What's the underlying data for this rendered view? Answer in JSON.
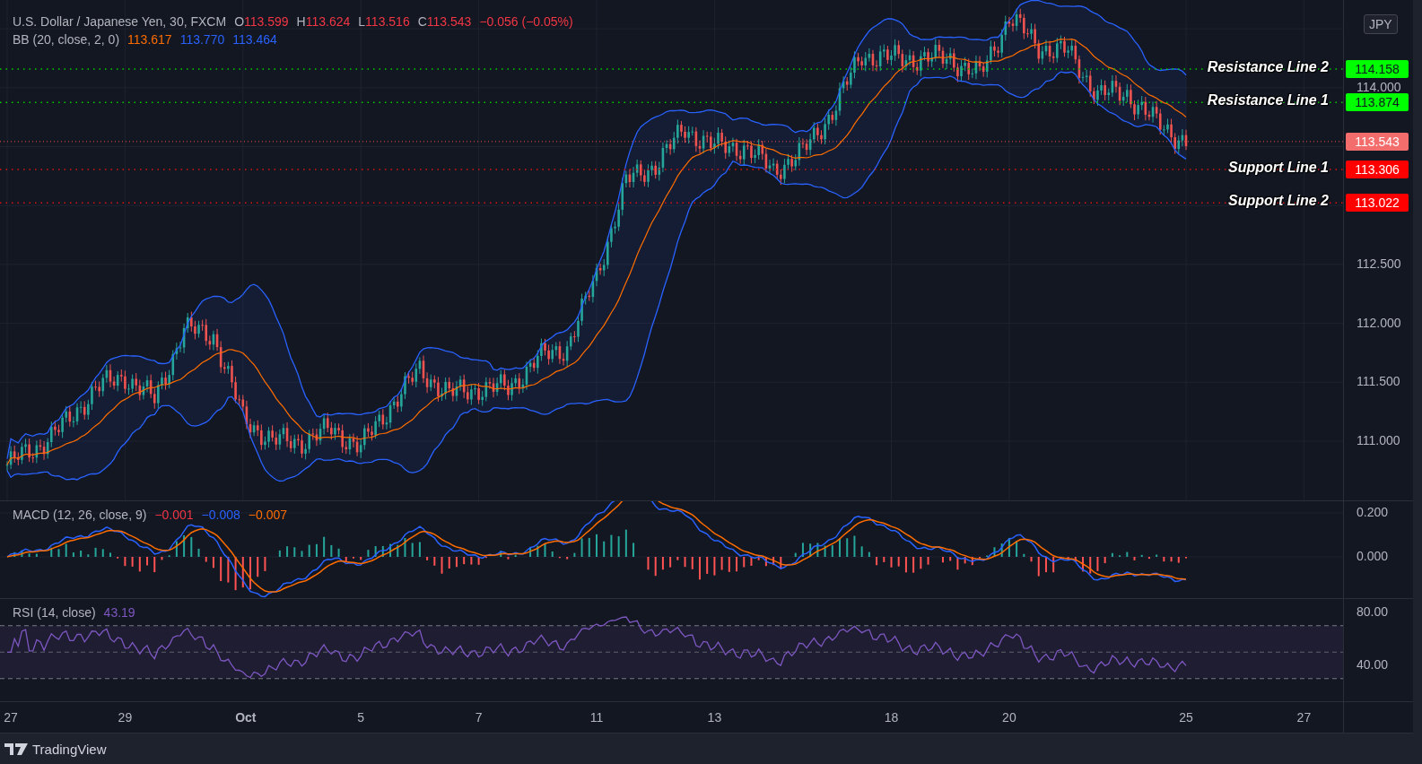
{
  "legend": {
    "symbol": "U.S. Dollar / Japanese Yen, 30, FXCM",
    "ohlc": [
      {
        "label": "O",
        "value": "113.599"
      },
      {
        "label": "H",
        "value": "113.624"
      },
      {
        "label": "L",
        "value": "113.516"
      },
      {
        "label": "C",
        "value": "113.543"
      }
    ],
    "change": "−0.056 (−0.05%)"
  },
  "bb_legend": {
    "label": "BB (20, close, 2, 0)",
    "values": [
      {
        "value": "113.617",
        "color": "#ff6d00"
      },
      {
        "value": "113.770",
        "color": "#2962ff"
      },
      {
        "value": "113.464",
        "color": "#2962ff"
      }
    ]
  },
  "currency_badge": "JPY",
  "levels": [
    {
      "label": "Resistance Line 2",
      "price": "114.158",
      "kind": "resistance"
    },
    {
      "label": "Resistance Line 1",
      "price": "113.874",
      "kind": "resistance"
    },
    {
      "label": "Support Line 1",
      "price": "113.306",
      "kind": "support"
    },
    {
      "label": "Support Line 2",
      "price": "113.022",
      "kind": "support"
    }
  ],
  "last_price": "113.543",
  "price_axis": [
    "114.000",
    "112.500",
    "112.000",
    "111.500",
    "111.000"
  ],
  "macd": {
    "label": "MACD (12, 26, close, 9)",
    "values": [
      {
        "value": "−0.001",
        "color": "#f23645"
      },
      {
        "value": "−0.008",
        "color": "#2962ff"
      },
      {
        "value": "−0.007",
        "color": "#ff6d00"
      }
    ],
    "axis_labels": [
      "0.200",
      "0.000"
    ]
  },
  "rsi": {
    "label": "RSI (14, close)",
    "value": "43.19",
    "axis_labels": [
      "80.00",
      "40.00"
    ]
  },
  "time_axis": [
    {
      "label": "27",
      "emphasized": false
    },
    {
      "label": "29",
      "emphasized": false
    },
    {
      "label": "Oct",
      "emphasized": true
    },
    {
      "label": "5",
      "emphasized": false
    },
    {
      "label": "7",
      "emphasized": false
    },
    {
      "label": "11",
      "emphasized": false
    },
    {
      "label": "13",
      "emphasized": false
    },
    {
      "label": "18",
      "emphasized": false
    },
    {
      "label": "20",
      "emphasized": false
    },
    {
      "label": "25",
      "emphasized": false
    },
    {
      "label": "27",
      "emphasized": false
    }
  ],
  "footer": {
    "brand": "TradingView"
  }
}
